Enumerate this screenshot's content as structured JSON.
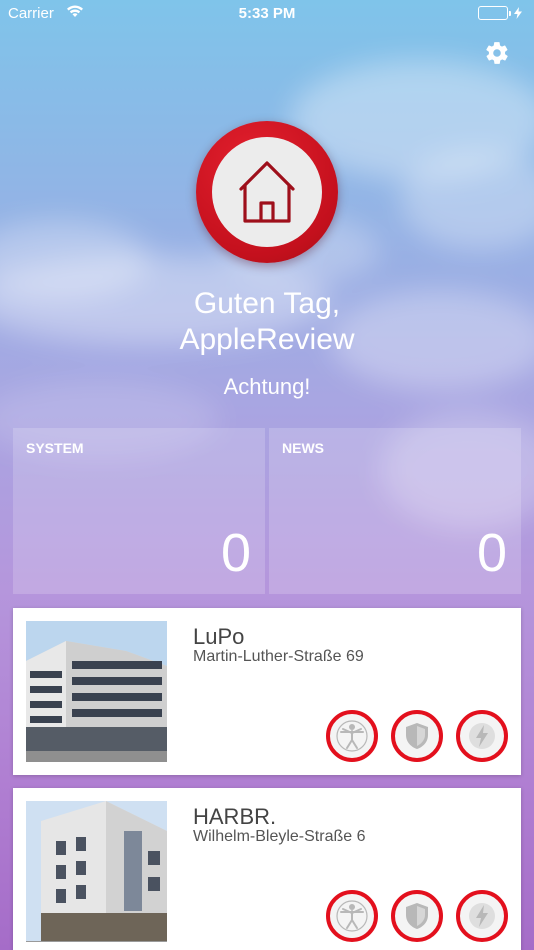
{
  "status_bar": {
    "carrier": "Carrier",
    "time": "5:33 PM"
  },
  "header": {
    "settings_icon": "gear-icon",
    "logo_icon": "house-icon"
  },
  "greeting": {
    "line1": "Guten Tag,",
    "line2": "AppleReview",
    "alert": "Achtung!"
  },
  "tiles": [
    {
      "label": "SYSTEM",
      "count": "0"
    },
    {
      "label": "NEWS",
      "count": "0"
    }
  ],
  "buildings": [
    {
      "name": "LuPo",
      "address": "Martin-Luther-Straße 69",
      "icons": [
        "person-icon",
        "shield-icon",
        "lightning-icon"
      ]
    },
    {
      "name": "HARBR.",
      "address": "Wilhelm-Bleyle-Straße 6",
      "icons": [
        "person-icon",
        "shield-icon",
        "lightning-icon"
      ]
    }
  ],
  "colors": {
    "accent_red": "#e3101d",
    "battery_green": "#4cd964"
  }
}
